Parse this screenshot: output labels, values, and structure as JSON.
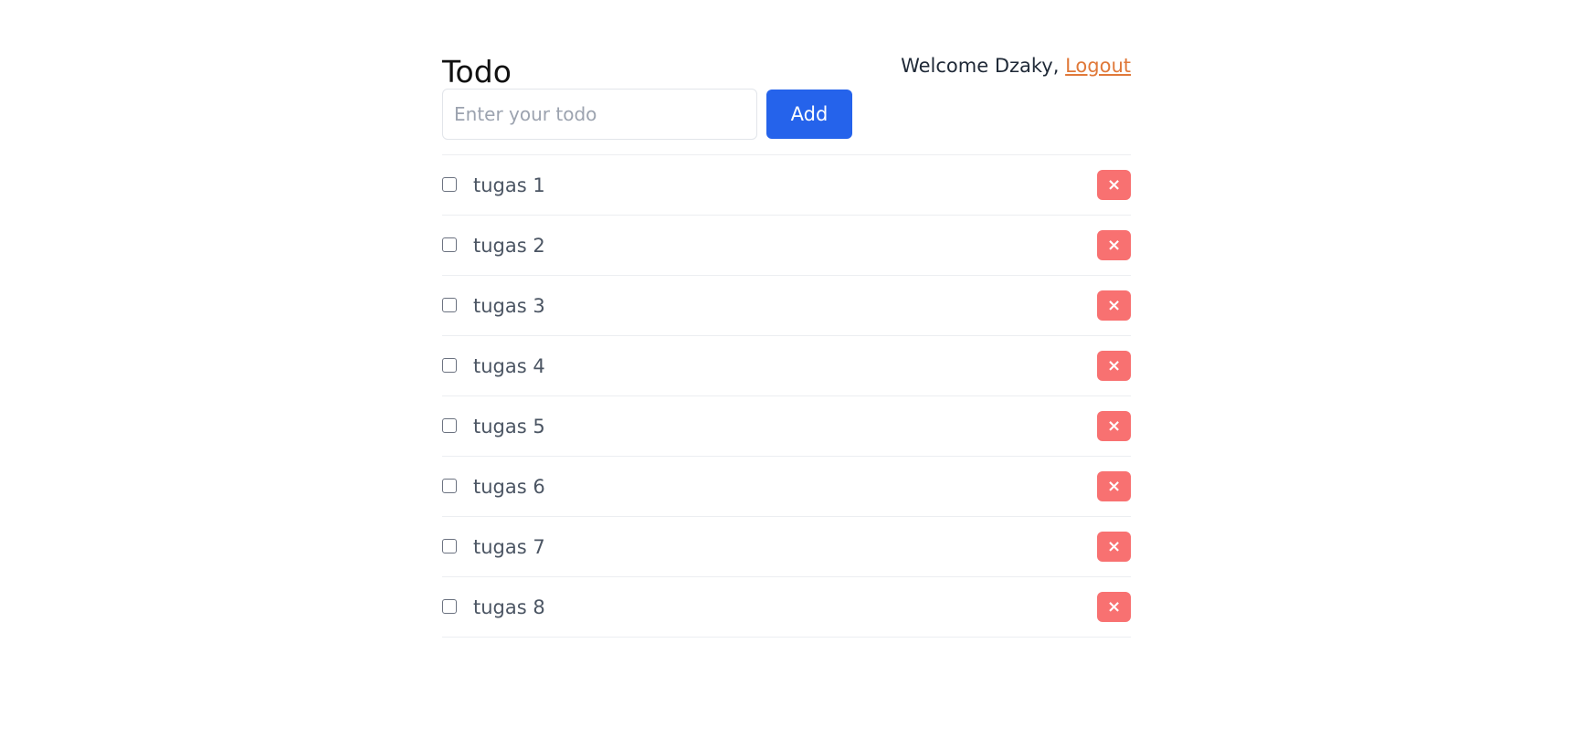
{
  "header": {
    "title": "Todo",
    "welcome_text": "Welcome Dzaky,",
    "logout_label": "Logout"
  },
  "form": {
    "input_value": "",
    "input_placeholder": "Enter your todo",
    "add_label": "Add"
  },
  "todos": [
    {
      "text": "tugas 1",
      "done": false,
      "delete_icon": "×"
    },
    {
      "text": "tugas 2",
      "done": false,
      "delete_icon": "×"
    },
    {
      "text": "tugas 3",
      "done": false,
      "delete_icon": "×"
    },
    {
      "text": "tugas 4",
      "done": false,
      "delete_icon": "×"
    },
    {
      "text": "tugas 5",
      "done": false,
      "delete_icon": "×"
    },
    {
      "text": "tugas 6",
      "done": false,
      "delete_icon": "×"
    },
    {
      "text": "tugas 7",
      "done": false,
      "delete_icon": "×"
    },
    {
      "text": "tugas 8",
      "done": false,
      "delete_icon": "×"
    }
  ],
  "colors": {
    "add_button": "#2563eb",
    "delete_button": "#f87171",
    "logout_link": "#e0793a"
  }
}
